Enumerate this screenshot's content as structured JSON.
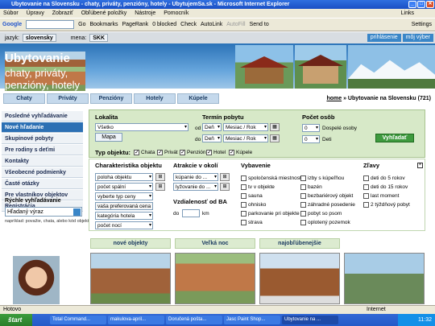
{
  "window": {
    "title": "Ubytovanie na Slovensku - chaty, priváty, penzióny, hotely - UbytujemSa.sk - Microsoft Internet Explorer",
    "btn_min": "_",
    "btn_max": "□",
    "btn_close": "✕"
  },
  "menu": {
    "items": [
      "Súbor",
      "Úpravy",
      "Zobraziť",
      "Obľúbené položky",
      "Nástroje",
      "Pomocník"
    ],
    "links": "Links"
  },
  "toolbar": {
    "google": "Google",
    "go": "Go",
    "bookmarks": "Bookmarks",
    "pagerank": "PageRank",
    "blocked": "0 blocked",
    "check": "Check",
    "autolink": "AutoLink",
    "autofill": "AutoFill",
    "sendto": "Send to",
    "settings": "Settings"
  },
  "sitebar": {
    "jazyk_label": "jazyk:",
    "jazyk_value": "slovensky",
    "mena_label": "mena:",
    "mena_value": "SKK",
    "prihlasenie": "prihlásenie",
    "moj_vyber": "môj výber"
  },
  "banner": {
    "title": "Ubytovanie na Slovensku",
    "subtitle": "chaty, priváty, penzióny, hotely"
  },
  "nav_tabs": [
    "Chaty",
    "Priváty",
    "Penzióny",
    "Hotely",
    "Kúpele"
  ],
  "breadcrumb": {
    "home": "home",
    "rest": " » Ubytovanie na Slovensku (721)"
  },
  "sidebar": {
    "items": [
      "Posledné vyhľadávanie",
      "Nové hľadanie",
      "Skupinové pobyty",
      "Pre rodiny s deťmi",
      "Kontakty",
      "Všeobecné podmienky",
      "Časté otázky",
      "Pre vlastníkov objektov",
      "Registrácia"
    ],
    "quick_title": "Rýchle vyhľadávanie",
    "quick_placeholder": "Hľadaný výraz",
    "quick_hint": "napríklad: považie, chata, alebo kód objektu"
  },
  "search": {
    "lokalita_label": "Lokalita",
    "lokalita_value": "Všetko",
    "mapa": "Mapa",
    "termin_label": "Termín pobytu",
    "od": "od",
    "do": "do",
    "den": "Deň",
    "mesiac": "Mesiac / Rok",
    "pocet_label": "Počet osôb",
    "dospele": "Dospelé osoby",
    "deti": "Deti",
    "dospele_val": "0",
    "deti_val": "0",
    "submit": "Vyhľadať",
    "typ_label": "Typ objektu:",
    "types": [
      "Chata",
      "Privát",
      "Penzión",
      "Hotel",
      "Kúpele"
    ]
  },
  "detail": {
    "char_title": "Charakteristika objektu",
    "char_selects": [
      "poloha objektu",
      "počet spální",
      "vyberte typ ceny",
      "vaša preferovaná cena",
      "kategória hotela",
      "počet nocí"
    ],
    "atrakcie_title": "Atrakcie v okolí",
    "atrakcie_selects": [
      "kúpanie do ...",
      "lyžovanie do ..."
    ],
    "vzd_title": "Vzdialenosť od BA",
    "vzd_do": "do",
    "vzd_km": "km",
    "vybavenie_title": "Vybavenie",
    "vybavenie_col1": [
      "spoločenská miestnosť",
      "tv v objekte",
      "sauna",
      "ohnisko",
      "parkovanie pri objekte",
      "strava"
    ],
    "vybavenie_col2": [
      "izby s kúpeľňou",
      "bazén",
      "bezbariérový objekt",
      "záhradné posedenie",
      "pobyt so psom",
      "oplotený pozemok"
    ],
    "zlavy_title": "Zľavy",
    "zlavy": [
      "deti do 5 rokov",
      "deti do 15 rokov",
      "last moment",
      "2 týždňový pobyt"
    ],
    "close": "×"
  },
  "sections": [
    "nové objekty",
    "Veľká noc",
    "najobľúbenejšie"
  ],
  "status": {
    "text": "Hotovo",
    "zone": "Internet"
  },
  "taskbar": {
    "start": "štart",
    "tasks": [
      "Total Command...",
      "makulova-april...",
      "Doručená pošta...",
      "Jasc Paint Shop...",
      "Ubytovanie na ..."
    ],
    "clock": "11:32"
  }
}
